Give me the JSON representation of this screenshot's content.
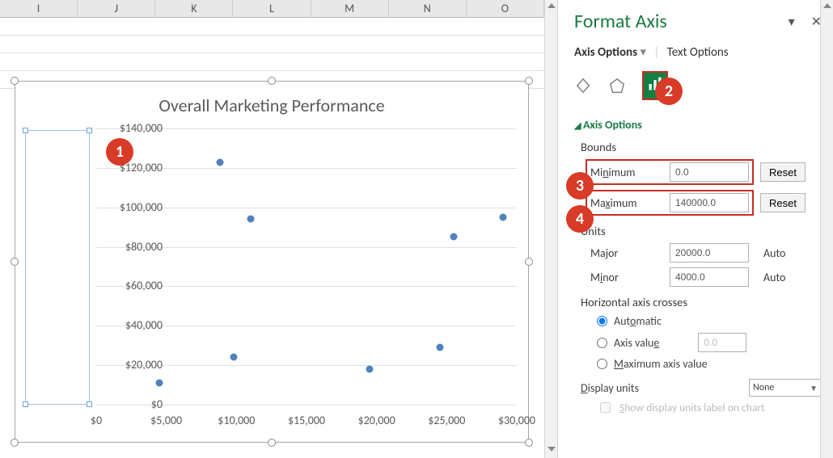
{
  "col_headers": [
    "I",
    "J",
    "K",
    "L",
    "M",
    "N",
    "O"
  ],
  "chart_data": {
    "type": "scatter",
    "title": "Overall Marketing Performance",
    "xlabel": "",
    "ylabel": "",
    "xlim": [
      0,
      30000
    ],
    "ylim": [
      0,
      140000
    ],
    "xticks": [
      "$0",
      "$5,000",
      "$10,000",
      "$15,000",
      "$20,000",
      "$25,000",
      "$30,000"
    ],
    "yticks": [
      "$0",
      "$20,000",
      "$40,000",
      "$60,000",
      "$80,000",
      "$100,000",
      "$120,000",
      "$140,000"
    ],
    "points": [
      {
        "x": 4500,
        "y": 11000
      },
      {
        "x": 8800,
        "y": 123000
      },
      {
        "x": 9800,
        "y": 24000
      },
      {
        "x": 11000,
        "y": 94000
      },
      {
        "x": 19500,
        "y": 18000
      },
      {
        "x": 24500,
        "y": 29000
      },
      {
        "x": 25500,
        "y": 85000
      },
      {
        "x": 29000,
        "y": 95000
      }
    ]
  },
  "badges": {
    "b1": "1",
    "b2": "2",
    "b3": "3",
    "b4": "4"
  },
  "pane": {
    "title": "Format Axis",
    "tabs": {
      "axis_options": "Axis Options",
      "text_options": "Text Options"
    },
    "section": "Axis Options",
    "bounds": {
      "label": "Bounds",
      "min_label": "Minimum",
      "min_value": "0.0",
      "min_btn": "Reset",
      "max_label": "Maximum",
      "max_value": "140000.0",
      "max_btn": "Reset"
    },
    "units": {
      "label": "Units",
      "major_label": "Major",
      "major_value": "20000.0",
      "major_state": "Auto",
      "minor_label": "Minor",
      "minor_value": "4000.0",
      "minor_state": "Auto"
    },
    "crosses": {
      "label": "Horizontal axis crosses",
      "auto": "Automatic",
      "axis_value": "Axis value",
      "axis_value_num": "0.0",
      "max": "Maximum axis value"
    },
    "display_units": {
      "label": "Display units",
      "value": "None",
      "chk": "Show display units label on chart"
    }
  }
}
